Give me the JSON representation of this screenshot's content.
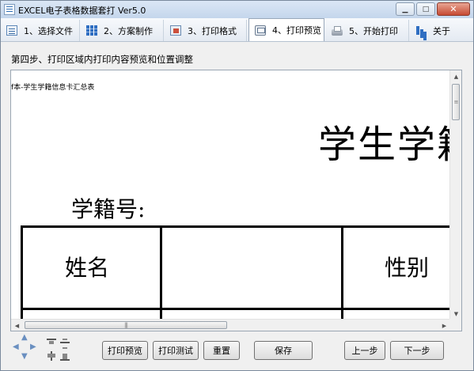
{
  "window": {
    "title": "EXCEL电子表格数据套打 Ver5.0",
    "controls": {
      "minimize": "▁",
      "maximize": "□",
      "close": "✕"
    }
  },
  "tabs": [
    {
      "label": "1、选择文件",
      "icon": "list-icon",
      "active": false
    },
    {
      "label": "2、方案制作",
      "icon": "grid-icon",
      "active": false
    },
    {
      "label": "3、打印格式",
      "icon": "format-icon",
      "active": false
    },
    {
      "label": "4、打印预览",
      "icon": "print-preview-icon",
      "active": true
    },
    {
      "label": "5、开始打印",
      "icon": "printer-icon",
      "active": false
    },
    {
      "label": "关于",
      "icon": "chart-icon",
      "active": false
    }
  ],
  "step_heading": "第四步、打印区域内打印内容预览和位置调整",
  "preview": {
    "document_name": "f本-学生学籍信息卡汇总表",
    "title_text": "学生学籍",
    "student_no_label": "学籍号:",
    "cells": {
      "name": "姓名",
      "gender": "性别"
    }
  },
  "buttons": {
    "print_preview": "打印预览",
    "print_test": "打印测试",
    "reset": "重置",
    "save": "保存",
    "prev": "上一步",
    "next": "下一步"
  }
}
